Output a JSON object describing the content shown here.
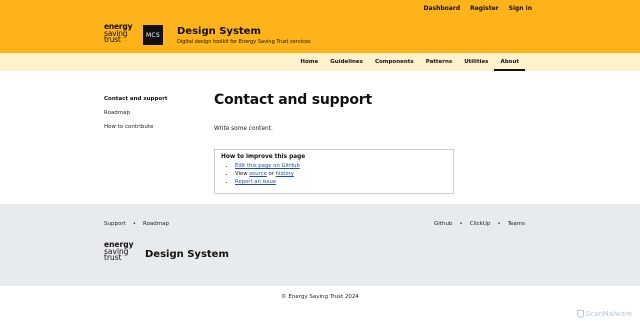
{
  "header": {
    "utility_nav": [
      "Dashboard",
      "Register",
      "Sign in"
    ],
    "logo_lines": [
      "energy",
      "saving",
      "trust"
    ],
    "mcs_logo": "MCS",
    "title": "Design System",
    "tagline": "Digital design toolkit for Energy Saving Trust services",
    "background": "#ffb31a"
  },
  "main_nav": {
    "items": [
      "Home",
      "Guidelines",
      "Components",
      "Patterns",
      "Utilities",
      "About"
    ],
    "active": "About",
    "background": "#fff2cc"
  },
  "sidenav": {
    "items": [
      "Contact and support",
      "Roadmap",
      "How to contribute"
    ],
    "current": "Contact and support"
  },
  "content": {
    "title": "Contact and support",
    "body": "Write some content.",
    "improve": {
      "heading": "How to improve this page",
      "item1_link": "Edit this page on GitHub",
      "item2_prefix": "View",
      "item2_link_source": "source",
      "item2_or": "or",
      "item2_link_history": "history",
      "item3_link": "Report an issue"
    }
  },
  "footer": {
    "left_links": [
      "Support",
      "Roadmap"
    ],
    "right_links": [
      "Github",
      "ClickUp",
      "Teams"
    ],
    "separator": "•",
    "logo_lines": [
      "energy",
      "saving",
      "trust"
    ],
    "title": "Design System",
    "background": "#e8ebee"
  },
  "copyright": "© Energy Saving Trust 2024",
  "watermark": "ScanMalware",
  "colors": {
    "link": "#1d4fb8",
    "text": "#111111"
  }
}
